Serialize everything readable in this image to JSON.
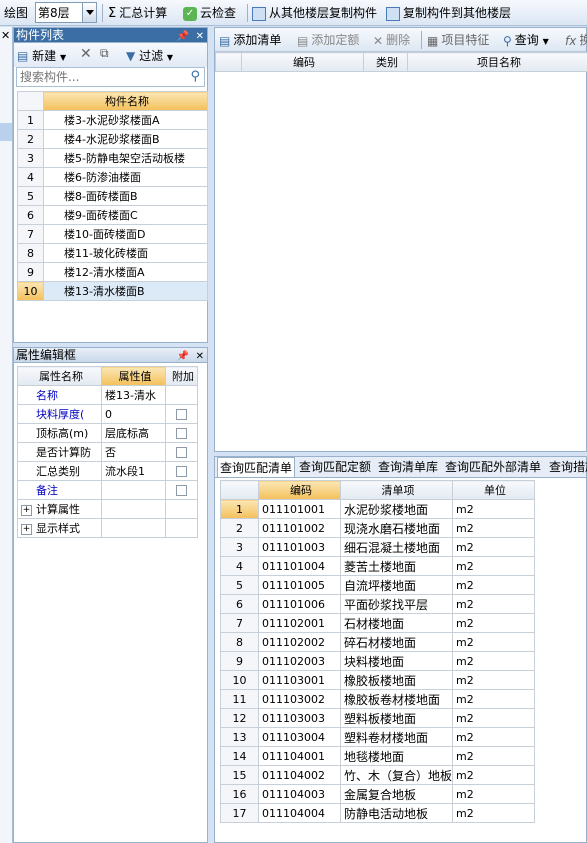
{
  "toolbar": {
    "draw_label": "绘图",
    "floor_value": "第8层",
    "summary_label": "汇总计算",
    "cloud_check_label": "云检查",
    "copy_from_label": "从其他楼层复制构件",
    "copy_to_label": "复制构件到其他楼层"
  },
  "component_list": {
    "title": "构件列表",
    "new_label": "新建",
    "filter_label": "过滤",
    "search_placeholder": "搜索构件...",
    "column_header": "构件名称",
    "rows": [
      {
        "num": "1",
        "name": "楼3-水泥砂浆楼面A"
      },
      {
        "num": "2",
        "name": "楼4-水泥砂浆楼面B"
      },
      {
        "num": "3",
        "name": "楼5-防静电架空活动板楼"
      },
      {
        "num": "4",
        "name": "楼6-防渗油楼面"
      },
      {
        "num": "5",
        "name": "楼8-面砖楼面B"
      },
      {
        "num": "6",
        "name": "楼9-面砖楼面C"
      },
      {
        "num": "7",
        "name": "楼10-面砖楼面D"
      },
      {
        "num": "8",
        "name": "楼11-玻化砖楼面"
      },
      {
        "num": "9",
        "name": "楼12-清水楼面A"
      },
      {
        "num": "10",
        "name": "楼13-清水楼面B"
      }
    ]
  },
  "property_editor": {
    "title": "属性编辑框",
    "col_name": "属性名称",
    "col_value": "属性值",
    "col_extra": "附加",
    "rows": [
      {
        "name": "名称",
        "value": "楼13-清水"
      },
      {
        "name": "块料厚度(",
        "value": "0"
      },
      {
        "name": "顶标高(m)",
        "value": "层底标高"
      },
      {
        "name": "是否计算防",
        "value": "否"
      },
      {
        "name": "汇总类别",
        "value": "流水段1"
      },
      {
        "name": "备注",
        "value": ""
      }
    ],
    "groups": [
      "计算属性",
      "显示样式"
    ]
  },
  "right_toolbar": {
    "add_list_label": "添加清单",
    "add_quota_label": "添加定额",
    "delete_label": "删除",
    "feature_label": "项目特征",
    "query_label": "查询",
    "extra_label": "换"
  },
  "upper_table": {
    "headers": [
      "编码",
      "类别",
      "项目名称"
    ]
  },
  "query_tabs": [
    "查询匹配清单",
    "查询匹配定额",
    "查询清单库",
    "查询匹配外部清单",
    "查询措施"
  ],
  "lower_table": {
    "headers": [
      "编码",
      "清单项",
      "单位"
    ],
    "rows": [
      {
        "num": "1",
        "code": "011101001",
        "item": "水泥砂浆楼地面",
        "unit": "m2"
      },
      {
        "num": "2",
        "code": "011101002",
        "item": "现浇水磨石楼地面",
        "unit": "m2"
      },
      {
        "num": "3",
        "code": "011101003",
        "item": "细石混凝土楼地面",
        "unit": "m2"
      },
      {
        "num": "4",
        "code": "011101004",
        "item": "菱苦土楼地面",
        "unit": "m2"
      },
      {
        "num": "5",
        "code": "011101005",
        "item": "自流坪楼地面",
        "unit": "m2"
      },
      {
        "num": "6",
        "code": "011101006",
        "item": "平面砂浆找平层",
        "unit": "m2"
      },
      {
        "num": "7",
        "code": "011102001",
        "item": "石材楼地面",
        "unit": "m2"
      },
      {
        "num": "8",
        "code": "011102002",
        "item": "碎石材楼地面",
        "unit": "m2"
      },
      {
        "num": "9",
        "code": "011102003",
        "item": "块料楼地面",
        "unit": "m2"
      },
      {
        "num": "10",
        "code": "011103001",
        "item": "橡胶板楼地面",
        "unit": "m2"
      },
      {
        "num": "11",
        "code": "011103002",
        "item": "橡胶板卷材楼地面",
        "unit": "m2"
      },
      {
        "num": "12",
        "code": "011103003",
        "item": "塑料板楼地面",
        "unit": "m2"
      },
      {
        "num": "13",
        "code": "011103004",
        "item": "塑料卷材楼地面",
        "unit": "m2"
      },
      {
        "num": "14",
        "code": "011104001",
        "item": "地毯楼地面",
        "unit": "m2"
      },
      {
        "num": "15",
        "code": "011104002",
        "item": "竹、木（复合）地板",
        "unit": "m2"
      },
      {
        "num": "16",
        "code": "011104003",
        "item": "金属复合地板",
        "unit": "m2"
      },
      {
        "num": "17",
        "code": "011104004",
        "item": "防静电活动地板",
        "unit": "m2"
      }
    ]
  },
  "colors": {
    "header_orange": "#f3c05a",
    "panel_blue": "#3a6ea5",
    "selected_row": "#dce9f7"
  }
}
